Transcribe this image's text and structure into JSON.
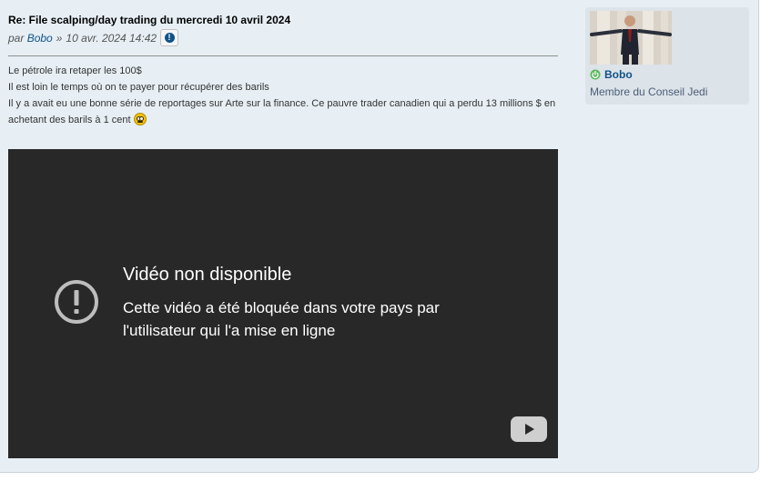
{
  "post": {
    "title": "Re: File scalping/day trading du mercredi 10 avril 2024",
    "by": "par",
    "author": "Bobo",
    "separator": "»",
    "datetime": "10 avr. 2024 14:42",
    "report_icon": "exclamation-circle-icon",
    "lines": [
      "Le pétrole ira retaper les 100$",
      "Il est loin le temps où on te payer pour récupérer des barils",
      "Il y a avait eu une bonne série de reportages sur Arte sur la finance. Ce pauvre trader canadien qui a perdu 13 millions $ en achetant des barils à 1 cent"
    ],
    "smiley_icon": "eek-smiley-icon"
  },
  "video": {
    "title": "Vidéo non disponible",
    "message": "Cette vidéo a été bloquée dans votre pays par l'utilisateur qui l'a mise en ligne",
    "warning_icon": "exclamation-circle-icon",
    "logo_icon": "youtube-play-icon"
  },
  "profile": {
    "username": "Bobo",
    "status_icon": "online-power-icon",
    "rank": "Membre du Conseil Jedi",
    "avatar_icon": "avatar-image"
  },
  "colors": {
    "post_bg": "#e7eff4",
    "profile_bg": "#dce3e9",
    "link": "#105289",
    "online": "#5cb85c",
    "video_bg": "#282828"
  }
}
